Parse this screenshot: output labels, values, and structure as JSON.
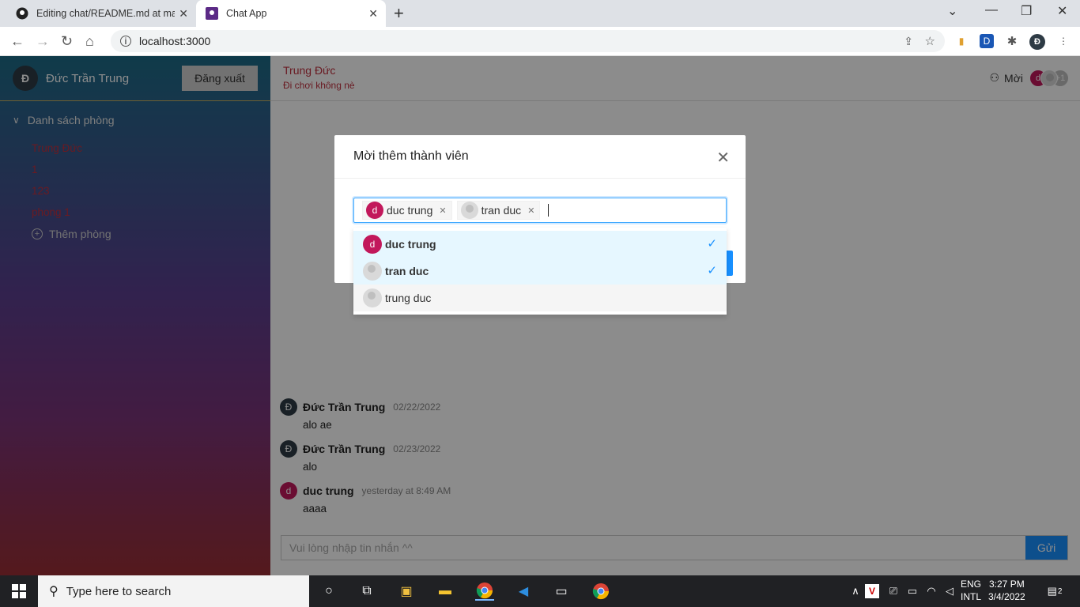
{
  "browser": {
    "tabs": [
      {
        "title": "Editing chat/README.md at main",
        "icon": "github-icon"
      },
      {
        "title": "Chat App",
        "icon": "app-icon"
      }
    ],
    "url": "localhost:3000",
    "profile_initial": "Đ",
    "ext_d": "D"
  },
  "sidebar": {
    "user_initial": "Đ",
    "user_name": "Đức Trần Trung",
    "logout_label": "Đăng xuất",
    "rooms_header": "Danh sách phòng",
    "rooms": [
      "Trung Đức",
      "1",
      "123",
      "phong 1"
    ],
    "add_room_label": "Thêm phòng"
  },
  "chat": {
    "room_name": "Trung Đức",
    "room_desc": "Đi chơi không nè",
    "invite_label": "Mời",
    "member_avatars": [
      "d",
      "",
      "+1"
    ],
    "messages": [
      {
        "initial": "Đ",
        "author": "Đức Trần Trung",
        "date": "02/22/2022",
        "text": "alo ae"
      },
      {
        "initial": "Đ",
        "author": "Đức Trần Trung",
        "date": "02/23/2022",
        "text": "alo"
      },
      {
        "initial": "d",
        "author": "duc trung",
        "date": "yesterday at 8:49 AM",
        "text": "aaaa"
      }
    ],
    "input_placeholder": "Vui lòng nhập tin nhắn ^^",
    "send_label": "Gửi"
  },
  "modal": {
    "title": "Mời thêm thành viên",
    "selected": [
      {
        "initial": "d",
        "name": "duc trung"
      },
      {
        "initial": "",
        "name": "tran duc"
      }
    ],
    "options": [
      {
        "initial": "d",
        "name": "duc trung",
        "selected": true
      },
      {
        "initial": "",
        "name": "tran duc",
        "selected": true
      },
      {
        "initial": "",
        "name": "trung duc",
        "selected": false
      }
    ]
  },
  "taskbar": {
    "search_placeholder": "Type here to search",
    "lang_top": "ENG",
    "lang_bottom": "INTL",
    "time": "3:27 PM",
    "date": "3/4/2022",
    "notifications": "2"
  },
  "colors": {
    "accent": "#1890ff",
    "room_text": "#c0303e",
    "avatar_pink": "#c2185b"
  }
}
